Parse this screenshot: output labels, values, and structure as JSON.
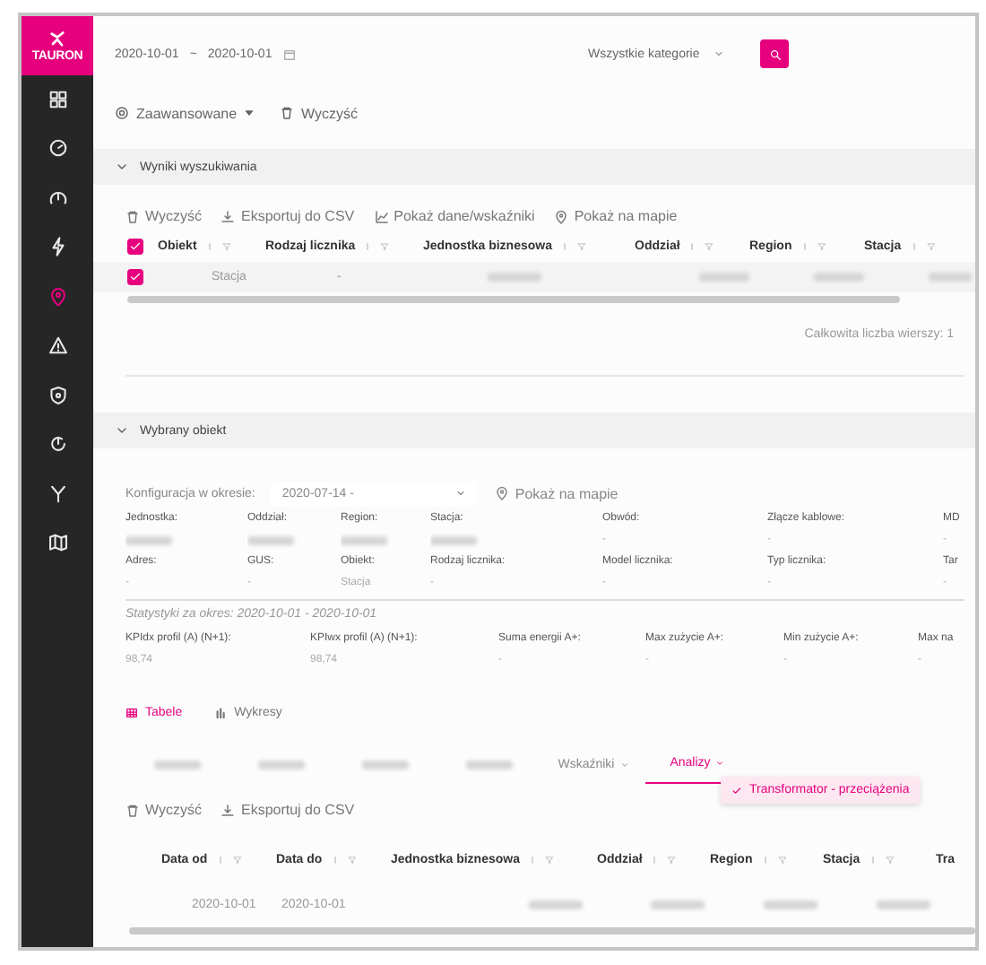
{
  "logo": {
    "name": "TAURON"
  },
  "sidebar": {
    "items": [
      {
        "kind": "grid",
        "selected": false
      },
      {
        "kind": "gauge",
        "selected": false
      },
      {
        "kind": "speed",
        "selected": false
      },
      {
        "kind": "bolt",
        "selected": false
      },
      {
        "kind": "pin",
        "selected": true
      },
      {
        "kind": "warning",
        "selected": false
      },
      {
        "kind": "shield",
        "selected": false
      },
      {
        "kind": "refresh",
        "selected": false
      },
      {
        "kind": "fork",
        "selected": false
      },
      {
        "kind": "map",
        "selected": false
      }
    ]
  },
  "search": {
    "date_from": "2020-10-01",
    "separator": "~",
    "date_to": "2020-10-01",
    "category": "Wszystkie kategorie"
  },
  "filters": {
    "advanced": "Zaawansowane",
    "clear": "Wyczyść"
  },
  "results": {
    "title": "Wyniki wyszukiwania",
    "expanded": true,
    "toolbar": [
      {
        "kind": "clear",
        "label": "Wyczyść"
      },
      {
        "kind": "export",
        "label": "Eksportuj do CSV"
      },
      {
        "kind": "chart",
        "label": "Pokaż dane/wskaźniki"
      },
      {
        "kind": "map",
        "label": "Pokaż na mapie"
      }
    ],
    "table": {
      "all_checked": true,
      "columns": [
        "Obiekt",
        "Rodzaj licznika",
        "Jednostka biznesowa",
        "Oddział",
        "Region",
        "Stacja"
      ],
      "rows": [
        {
          "checked": true,
          "cells": [
            {
              "kind": "text",
              "text": "Stacja"
            },
            {
              "kind": "text",
              "text": "-"
            },
            {
              "kind": "redacted"
            },
            {
              "kind": "redacted"
            },
            {
              "kind": "redacted"
            },
            {
              "kind": "redacted"
            }
          ]
        }
      ]
    },
    "total": "Całkowita liczba wierszy: 1"
  },
  "selected_object": {
    "title": "Wybrany obiekt",
    "expanded": true,
    "config_label": "Konfiguracja w okresie:",
    "config_value": "2020-07-14 -",
    "map": "Pokaż na mapie",
    "fields": [
      [
        {
          "label": "Jednostka:",
          "value": {
            "kind": "redacted"
          }
        },
        {
          "label": "Oddział:",
          "value": {
            "kind": "redacted"
          }
        },
        {
          "label": "Region:",
          "value": {
            "kind": "redacted"
          }
        },
        {
          "label": "Stacja:",
          "value": {
            "kind": "redacted"
          }
        },
        {
          "label": "Obwód:",
          "value": {
            "kind": "text",
            "text": "-"
          }
        },
        {
          "label": "Złącze kablowe:",
          "value": {
            "kind": "text",
            "text": "-"
          }
        },
        {
          "label": "MD",
          "value": {
            "kind": "text",
            "text": "-"
          }
        }
      ],
      [
        {
          "label": "Adres:",
          "value": {
            "kind": "text",
            "text": "-"
          }
        },
        {
          "label": "GUS:",
          "value": {
            "kind": "text",
            "text": "-"
          }
        },
        {
          "label": "Obiekt:",
          "value": {
            "kind": "text",
            "text": "Stacja"
          }
        },
        {
          "label": "Rodzaj licznika:",
          "value": {
            "kind": "text",
            "text": "-"
          }
        },
        {
          "label": "Model licznika:",
          "value": {
            "kind": "text",
            "text": "-"
          }
        },
        {
          "label": "Typ licznika:",
          "value": {
            "kind": "text",
            "text": "-"
          }
        },
        {
          "label": "Tar",
          "value": {
            "kind": "text",
            "text": "-"
          }
        }
      ]
    ],
    "stats_title": "Statystyki za okres: 2020-10-01 - 2020-10-01",
    "stats": [
      {
        "label": "KPIdx profil (A) (N+1):",
        "value": "98,74"
      },
      {
        "label": "KPIwx profil (A) (N+1):",
        "value": "98,74"
      },
      {
        "label": "Suma energii A+:",
        "value": "-"
      },
      {
        "label": "Max zużycie A+:",
        "value": "-"
      },
      {
        "label": "Min zużycie A+:",
        "value": "-"
      },
      {
        "label": "Max na",
        "value": "-"
      }
    ],
    "view_tabs": [
      {
        "kind": "table",
        "label": "Tabele",
        "selected": true
      },
      {
        "kind": "chart",
        "label": "Wykresy",
        "selected": false
      }
    ],
    "sub_tabs": [
      {
        "kind": "redacted",
        "selected": false
      },
      {
        "kind": "redacted",
        "selected": false
      },
      {
        "kind": "redacted",
        "selected": false
      },
      {
        "kind": "redacted",
        "selected": false
      },
      {
        "kind": "menu",
        "label": "Wskaźniki",
        "selected": false
      },
      {
        "kind": "menu",
        "label": "Analizy",
        "selected": true
      }
    ],
    "menu": [
      {
        "label": "Transformator - przeciążenia",
        "checked": true
      }
    ],
    "toolbar": [
      {
        "kind": "clear",
        "label": "Wyczyść"
      },
      {
        "kind": "export",
        "label": "Eksportuj do CSV"
      }
    ],
    "table": {
      "columns": [
        "Data od",
        "Data do",
        "Jednostka biznesowa",
        "Oddział",
        "Region",
        "Stacja",
        "Tra"
      ],
      "rows": [
        {
          "cells": [
            {
              "kind": "text",
              "text": "2020-10-01"
            },
            {
              "kind": "text",
              "text": "2020-10-01"
            },
            {
              "kind": "redacted"
            },
            {
              "kind": "redacted"
            },
            {
              "kind": "redacted"
            },
            {
              "kind": "redacted"
            }
          ]
        }
      ]
    }
  }
}
